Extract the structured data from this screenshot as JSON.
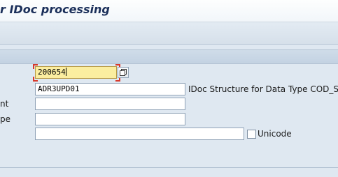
{
  "window": {
    "title": "r IDoc processing"
  },
  "form": {
    "row1": {
      "value": "200654"
    },
    "row2": {
      "value": "ADR3UPD01",
      "description": "IDoc Structure for Data Type COD_S_A"
    },
    "row3": {
      "label_fragment": "nt",
      "value": ""
    },
    "row4": {
      "label_fragment": "pe",
      "value": ""
    },
    "row5": {
      "value": "",
      "checkbox_label": "Unicode",
      "checkbox_checked": false
    }
  },
  "icons": {
    "value_help": "value-help-icon"
  }
}
